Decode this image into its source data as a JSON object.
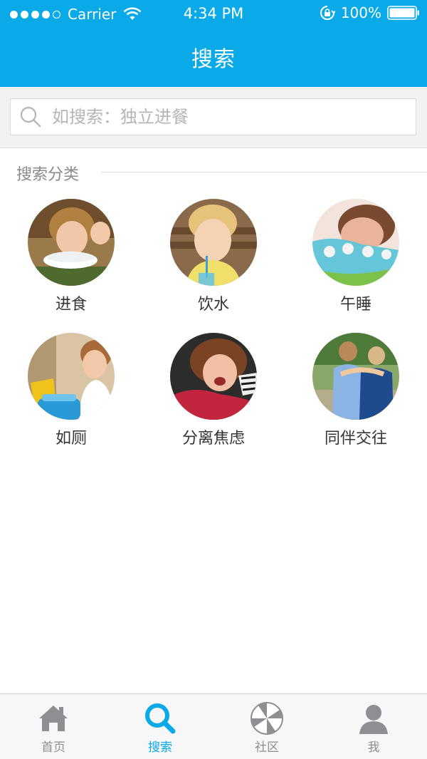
{
  "status_bar": {
    "carrier": "Carrier",
    "time": "4:34 PM",
    "battery": "100%"
  },
  "nav": {
    "title": "搜索"
  },
  "search": {
    "placeholder": "如搜索：独立进餐",
    "value": ""
  },
  "section": {
    "title": "搜索分类"
  },
  "categories": [
    {
      "label": "进食",
      "icon": "eating-photo"
    },
    {
      "label": "饮水",
      "icon": "drinking-photo"
    },
    {
      "label": "午睡",
      "icon": "nap-photo"
    },
    {
      "label": "如厕",
      "icon": "toilet-photo"
    },
    {
      "label": "分离焦虑",
      "icon": "separation-anxiety-photo"
    },
    {
      "label": "同伴交往",
      "icon": "peer-interaction-photo"
    }
  ],
  "tabbar": {
    "items": [
      {
        "label": "首页",
        "icon": "home-icon",
        "active": false
      },
      {
        "label": "搜索",
        "icon": "search-icon",
        "active": true
      },
      {
        "label": "社区",
        "icon": "community-icon",
        "active": false
      },
      {
        "label": "我",
        "icon": "profile-icon",
        "active": false
      }
    ]
  },
  "colors": {
    "accent": "#0aa9e8",
    "tab_inactive": "#8e8e93",
    "background": "#ffffff"
  }
}
